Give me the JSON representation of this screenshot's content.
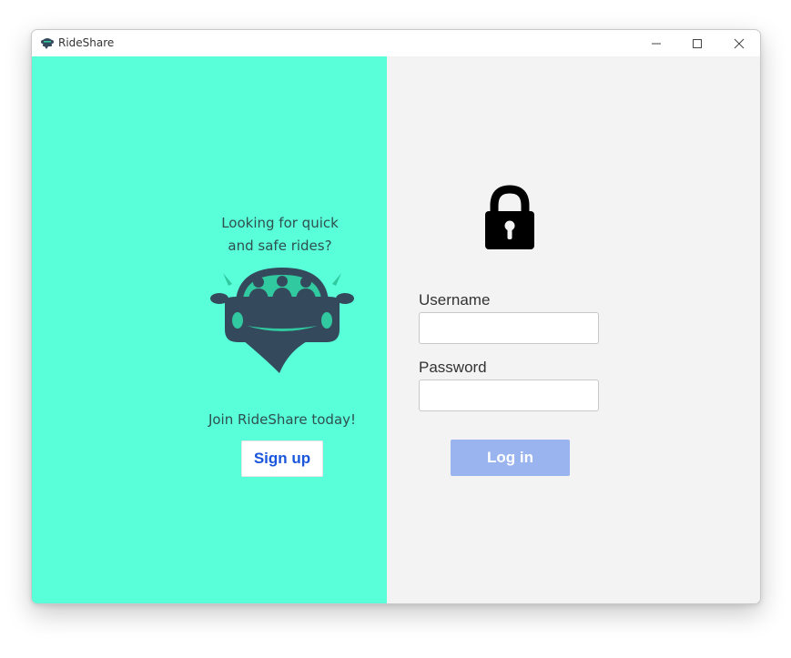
{
  "window": {
    "title": "RideShare",
    "icons": {
      "app": "car-icon",
      "minimize": "minimize-icon",
      "maximize": "maximize-icon",
      "close": "close-icon"
    }
  },
  "left_panel": {
    "tagline_line1": "Looking for quick",
    "tagline_line2": "and safe rides?",
    "logo_icon": "car-with-passengers-icon",
    "join_text": "Join RideShare today!",
    "signup_label": "Sign up"
  },
  "right_panel": {
    "lock_icon": "padlock-icon",
    "username_label": "Username",
    "username_value": "",
    "password_label": "Password",
    "password_value": "",
    "login_label": "Log in"
  },
  "colors": {
    "left_bg": "#58ffd8",
    "right_bg": "#f3f3f3",
    "car_body": "#344a5c",
    "car_accent": "#30c9a0",
    "signup_text": "#1a56db",
    "login_bg": "#9ab4ef",
    "login_text": "#ffffff"
  }
}
